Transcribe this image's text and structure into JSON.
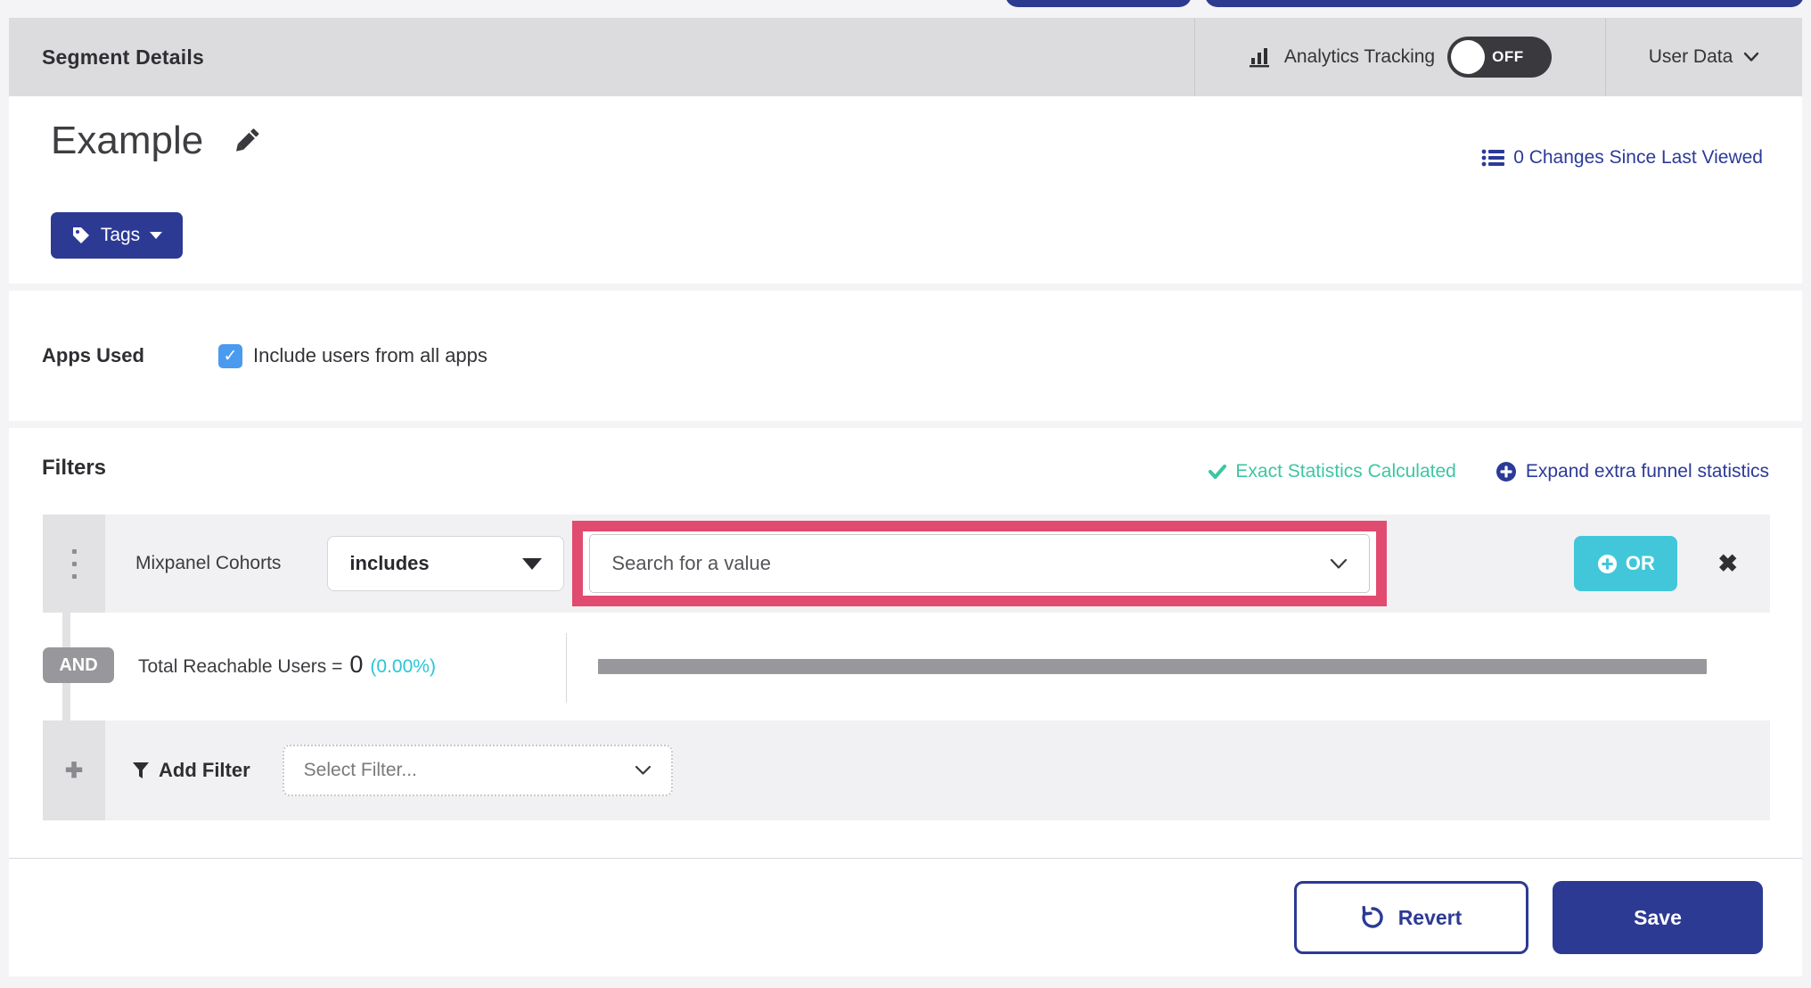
{
  "header": {
    "title": "Segment Details",
    "analytics_tracking": {
      "label": "Analytics Tracking",
      "toggle_state": "OFF"
    },
    "user_data": {
      "label": "User Data"
    }
  },
  "segment": {
    "name": "Example",
    "tags_label": "Tags",
    "changes_link": "0 Changes Since Last Viewed"
  },
  "apps_used": {
    "label": "Apps Used",
    "checkbox_label": "Include users from all apps",
    "checked": true,
    "check_glyph": "✓"
  },
  "filters": {
    "heading": "Filters",
    "status_text": "Exact Statistics Calculated",
    "expand_link": "Expand extra funnel statistics",
    "filter_row": {
      "name": "Mixpanel Cohorts",
      "operator": "includes",
      "value_placeholder": "Search for a value",
      "or_label": "OR",
      "close_glyph": "✖"
    },
    "and_label": "AND",
    "total_reachable": {
      "label": "Total Reachable Users =",
      "value": "0",
      "percent": "(0.00%)"
    },
    "add_filter": {
      "plus_glyph": "✚",
      "label": "Add Filter",
      "select_placeholder": "Select Filter..."
    }
  },
  "footer": {
    "revert_label": "Revert",
    "save_label": "Save"
  },
  "colors": {
    "navy": "#2c3a94",
    "teal_button": "#41c7d9",
    "teal_success": "#3cc6a2",
    "cyan_percent": "#29c5d6",
    "pink_highlight": "#e14b70",
    "checkbox_blue": "#4a9aef",
    "header_gray": "#dcdcde",
    "row_gray": "#f1f1f3",
    "handle_gray": "#e2e2e4",
    "bar_gray": "#98989c",
    "page_bg": "#f4f4f6"
  }
}
